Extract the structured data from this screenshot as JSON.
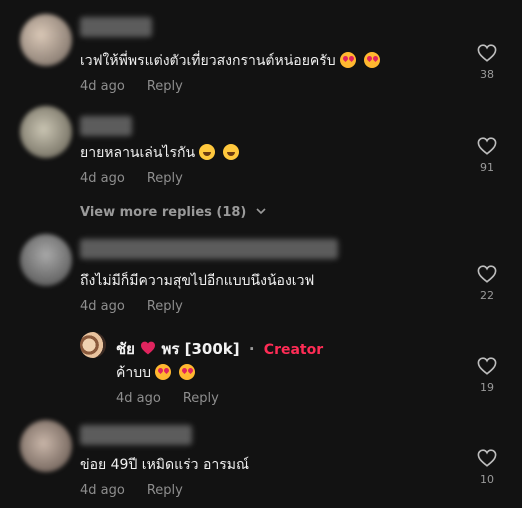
{
  "comments": [
    {
      "text": "เวฟให้พี่พรแต่งตัวเที่ยวสงกรานต์หน่อยครับ",
      "emojis": [
        "love",
        "love"
      ],
      "time": "4d ago",
      "reply": "Reply",
      "likes": "38"
    },
    {
      "text": "ยายหลานเล่นไรกัน",
      "emojis": [
        "laugh",
        "laugh"
      ],
      "time": "4d ago",
      "reply": "Reply",
      "likes": "91"
    },
    {
      "text": "ถึงไม่มีก็มีความสุขไปอีกแบบนึงน้องเวฟ",
      "time": "4d ago",
      "reply": "Reply",
      "likes": "22"
    },
    {
      "text": "ข่อย 49ปี เหมิดแร่ว อารมณ์",
      "time": "4d ago",
      "reply": "Reply",
      "likes": "10"
    }
  ],
  "view_more": "View more replies (18)",
  "creator_reply": {
    "name_part1": "ชัย",
    "name_part2": "พร [300k]",
    "separator": "·",
    "badge": "Creator",
    "text": "ค้าบบ",
    "emojis": [
      "love",
      "love"
    ],
    "time": "4d ago",
    "reply": "Reply",
    "likes": "19"
  },
  "colors": {
    "background": "#121212",
    "creator_badge": "#fe2c55",
    "heart_emoji": "#e0245e"
  },
  "icons": [
    "heart-outline-icon",
    "chevron-down-icon",
    "red-heart-icon"
  ]
}
